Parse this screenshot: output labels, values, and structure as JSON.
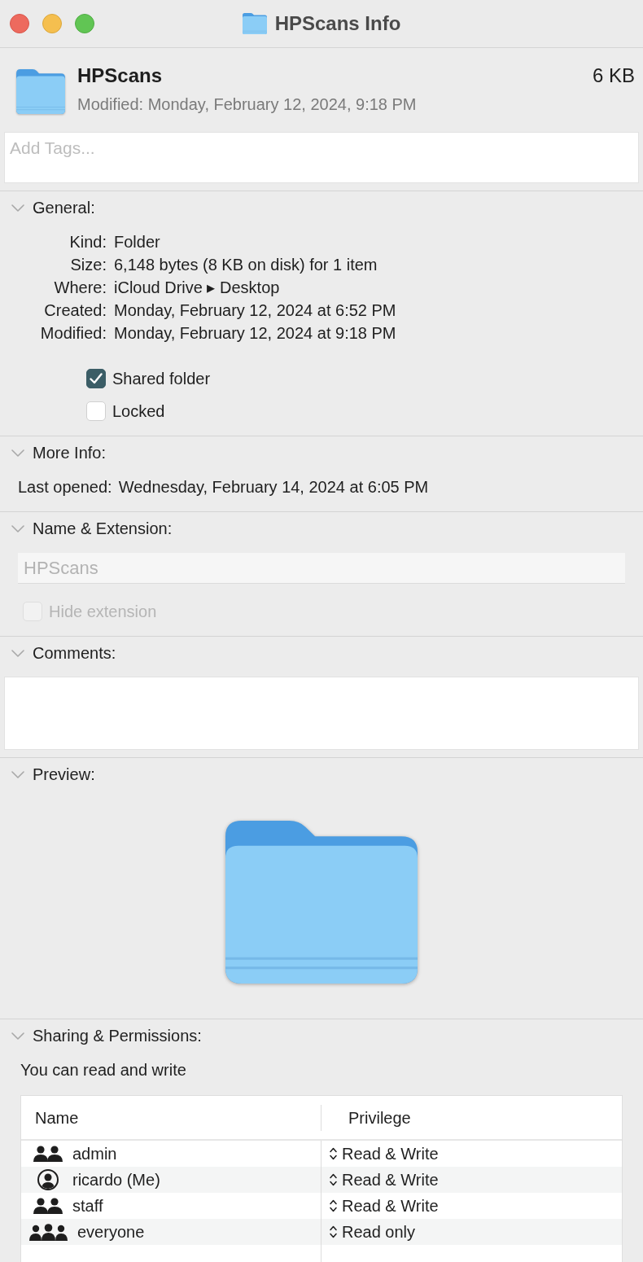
{
  "window": {
    "title": "HPScans Info"
  },
  "header": {
    "name": "HPScans",
    "size": "6 KB",
    "modified": "Modified: Monday, February 12, 2024, 9:18 PM"
  },
  "tags": {
    "placeholder": "Add Tags..."
  },
  "sections": [
    {
      "kind": "general",
      "title": "General:",
      "expanded": true,
      "fields": [
        {
          "label": "Kind:",
          "value": "Folder"
        },
        {
          "label": "Size:",
          "value": "6,148 bytes (8 KB on disk) for 1 item"
        },
        {
          "label": "Where:",
          "value": "iCloud Drive ▸ Desktop"
        },
        {
          "label": "Created:",
          "value": "Monday, February 12, 2024 at 6:52 PM"
        },
        {
          "label": "Modified:",
          "value": "Monday, February 12, 2024 at 9:18 PM"
        }
      ],
      "checkboxes": [
        {
          "label": "Shared folder",
          "checked": true
        },
        {
          "label": "Locked",
          "checked": false
        }
      ]
    },
    {
      "kind": "more_info",
      "title": "More Info:",
      "expanded": true,
      "fields": [
        {
          "label": "Last opened:",
          "value": "Wednesday, February 14, 2024 at 6:05 PM"
        }
      ]
    },
    {
      "kind": "name_extension",
      "title": "Name & Extension:",
      "expanded": true,
      "name_field": {
        "value": "HPScans",
        "disabled": true
      },
      "hide_extension": {
        "label": "Hide extension",
        "checked": false,
        "disabled": true
      }
    },
    {
      "kind": "comments",
      "title": "Comments:",
      "expanded": true
    },
    {
      "kind": "preview",
      "title": "Preview:",
      "expanded": true
    },
    {
      "kind": "sharing",
      "title": "Sharing & Permissions:",
      "expanded": true,
      "summary": "You can read and write",
      "table": {
        "columns": [
          "Name",
          "Privilege"
        ],
        "rows": [
          {
            "kind": "group",
            "name": "admin",
            "privilege": "Read & Write"
          },
          {
            "kind": "user",
            "name": "ricardo (Me)",
            "privilege": "Read & Write"
          },
          {
            "kind": "group",
            "name": "staff",
            "privilege": "Read & Write"
          },
          {
            "kind": "everyone",
            "name": "everyone",
            "privilege": "Read only"
          }
        ]
      }
    }
  ]
}
